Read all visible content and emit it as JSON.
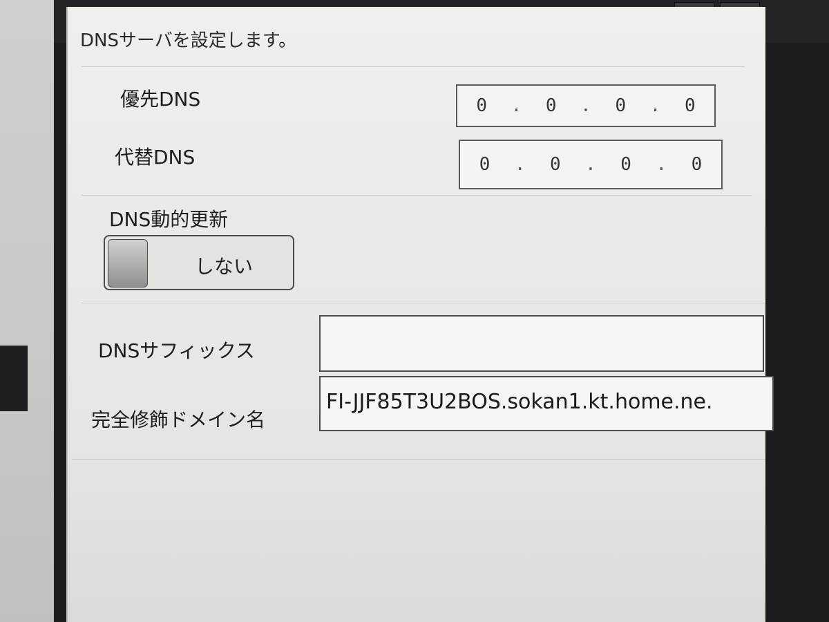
{
  "toolbar": {
    "help_icon": "question-circle",
    "keyboard_icon": "keyboard"
  },
  "panel": {
    "title": "DNSサーバを設定します。"
  },
  "preferred_dns": {
    "label": "優先DNS",
    "octets": [
      "0",
      "0",
      "0",
      "0"
    ]
  },
  "alternate_dns": {
    "label": "代替DNS",
    "octets": [
      "0",
      "0",
      "0",
      "0"
    ]
  },
  "dynamic_update": {
    "label": "DNS動的更新",
    "value": "しない"
  },
  "dns_suffix": {
    "label": "DNSサフィックス",
    "value": ""
  },
  "fqdn": {
    "label": "完全修飾ドメイン名",
    "value": "FI-JJF85T3U2BOS.sokan1.kt.home.ne."
  }
}
